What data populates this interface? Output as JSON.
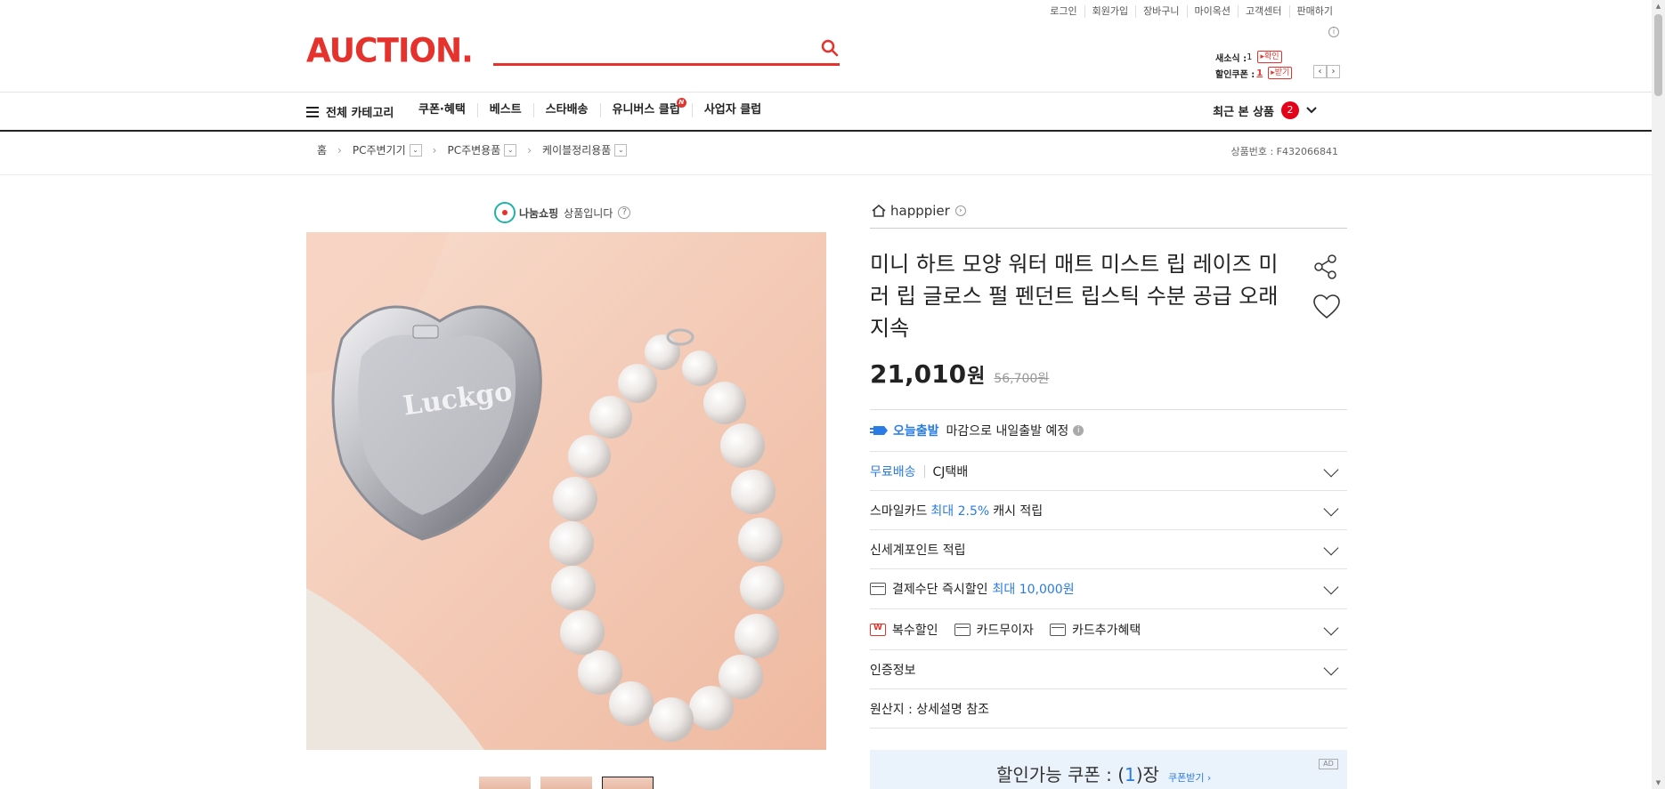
{
  "utility_nav": [
    "로그인",
    "회원가입",
    "장바구니",
    "마이옥션",
    "고객센터",
    "판매하기"
  ],
  "logo_text": "AUCTION.",
  "search": {
    "placeholder": ""
  },
  "header_right": {
    "news_label": "새소식 :",
    "news_count": "1",
    "news_button": "▸확인",
    "coupon_label": "할인쿠폰 :",
    "coupon_count": "1",
    "coupon_button": "▸받기"
  },
  "category_bar": {
    "all_label": "전체 카테고리",
    "links": [
      "쿠폰·혜택",
      "베스트",
      "스타배송",
      "유니버스 클럽",
      "사업자 클럽"
    ],
    "new_badge": "N",
    "recent_label": "최근 본 상품",
    "recent_count": "2"
  },
  "breadcrumb": {
    "home": "홈",
    "items": [
      "PC주변기기",
      "PC주변용품",
      "케이블정리용품"
    ]
  },
  "product_no": "상품번호 : F432066841",
  "share_badge": {
    "brand": "나눔쇼핑",
    "text": "상품입니다"
  },
  "image": {
    "engraving": "Luckgo"
  },
  "seller": "happpier",
  "title": "미니 하트 모양 워터 매트 미스트 립 레이즈 미러 립 글로스 펄 펜던트 립스틱 수분 공급 오래 지속",
  "price": {
    "sale": "21,010",
    "unit": "원",
    "original": "56,700원"
  },
  "rows": {
    "today_ship_badge": "오늘출발",
    "today_ship_text": "마감으로 내일출발 예정",
    "free_ship": "무료배송",
    "courier": "CJ택배",
    "smilecard_pre": "스마일카드",
    "smilecard_highlight": "최대 2.5%",
    "smilecard_post": "캐시 적립",
    "shinsegae": "신세계포인트 적립",
    "pay_discount_pre": "결제수단 즉시할인",
    "pay_discount_highlight": "최대 10,000원",
    "multi_discount": "복수할인",
    "card_installment": "카드무이자",
    "card_benefit": "카드추가혜택",
    "certification": "인증정보",
    "origin": "원산지 : 상세설명 참조"
  },
  "coupon": {
    "label": "할인가능 쿠폰 : (",
    "count": "1",
    "suffix": ")장",
    "get": "쿠폰받기 ›",
    "ad": "AD"
  }
}
